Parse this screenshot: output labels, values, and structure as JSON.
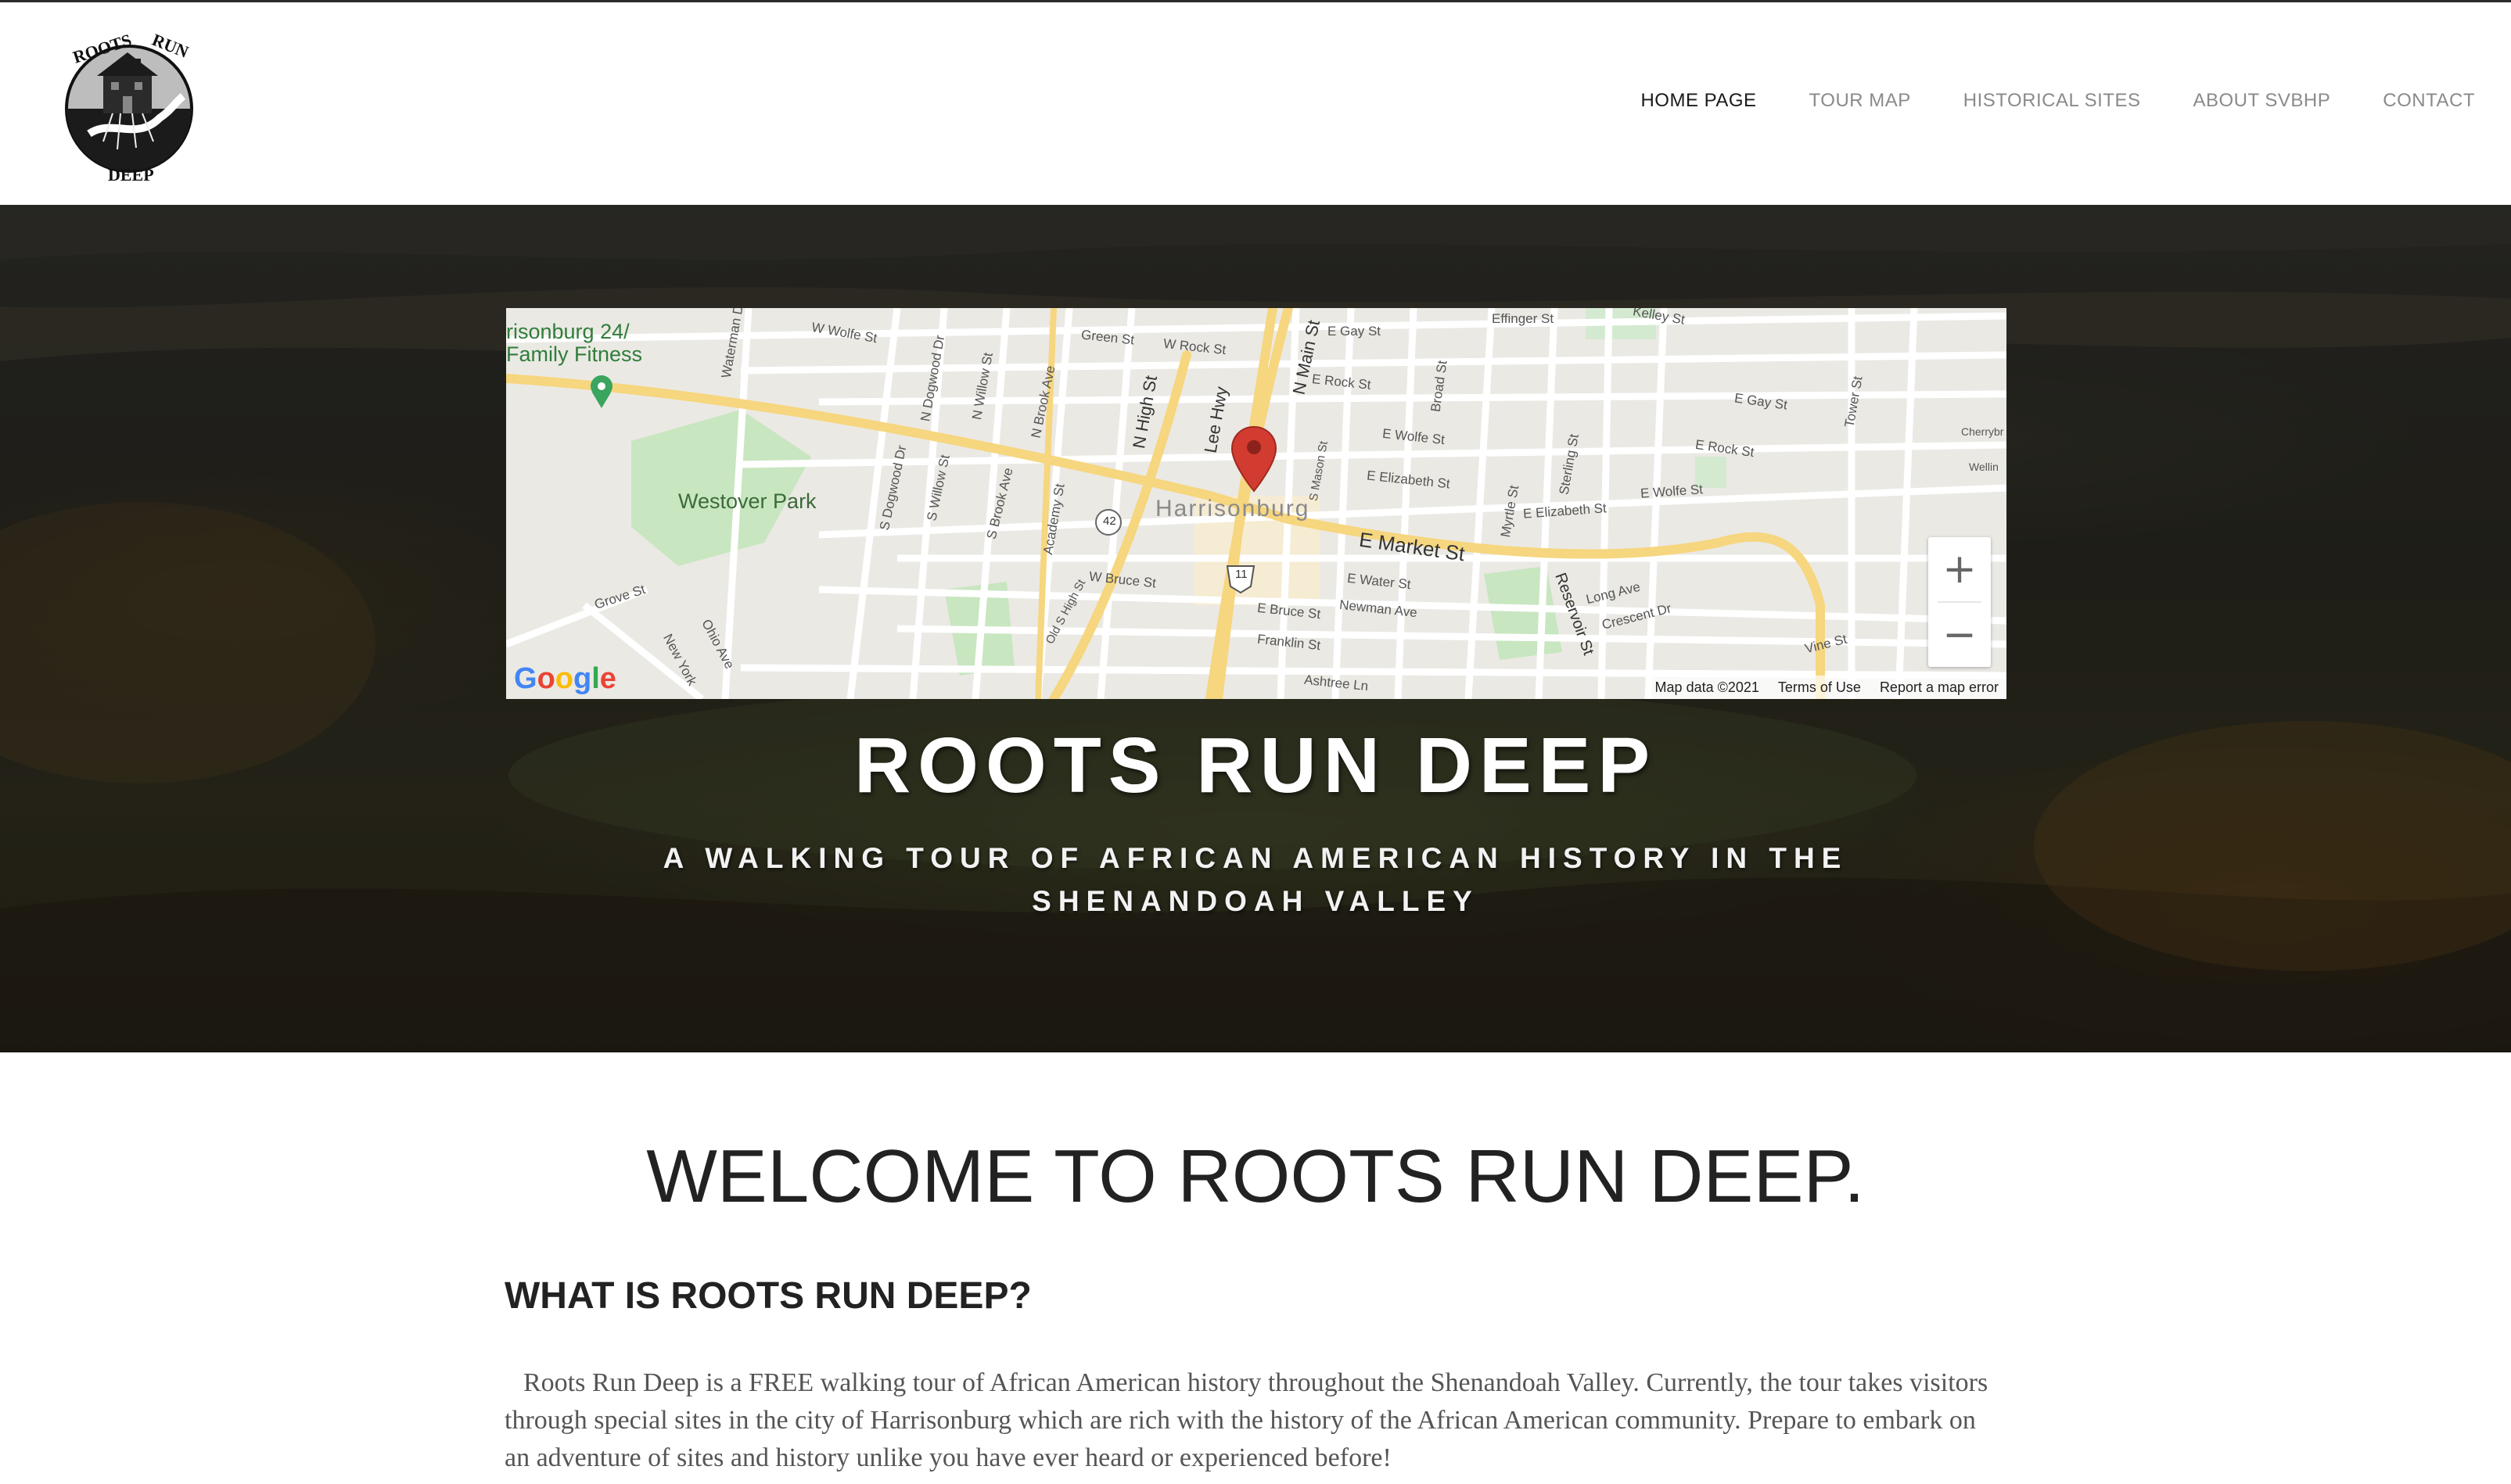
{
  "logo": {
    "top_text": "ROOTS",
    "top_text_2": "RUN",
    "bottom_text": "DEEP",
    "icon": "house-roots-logo"
  },
  "nav": {
    "items": [
      {
        "label": "HOME PAGE",
        "active": true
      },
      {
        "label": "TOUR MAP",
        "active": false
      },
      {
        "label": "HISTORICAL SITES",
        "active": false
      },
      {
        "label": "ABOUT SVBHP",
        "active": false
      },
      {
        "label": "CONTACT",
        "active": false
      }
    ]
  },
  "map": {
    "city_label": "Harrisonburg",
    "poi_park": "Westover Park",
    "poi_fitness_1": "risonburg 24/",
    "poi_fitness_2": "Family Fitness",
    "streets": {
      "e_market": "E Market St",
      "n_high": "N High St",
      "lee_hwy": "Lee Hwy",
      "n_main": "N Main St",
      "w_wolfe": "W Wolfe St",
      "green": "Green St",
      "w_rock": "W Rock St",
      "e_gay": "E Gay St",
      "e_rock": "E Rock St",
      "effinger": "Effinger St",
      "kelley": "Kelley St",
      "e_wolfe": "E Wolfe St",
      "e_elizabeth": "E Elizabeth St",
      "e_water": "E Water St",
      "newman": "Newman Ave",
      "franklin": "Franklin St",
      "e_bruce": "E Bruce St",
      "w_bruce": "W Bruce St",
      "reservoir": "Reservoir St",
      "long_ave": "Long Ave",
      "crescent": "Crescent Dr",
      "grove": "Grove St",
      "ohio": "Ohio Ave",
      "new_york": "New York",
      "s_dogwood": "S Dogwood Dr",
      "s_willow": "S Willow St",
      "s_brook": "S Brook Ave",
      "academy": "Academy St",
      "old_s_high": "Old S High St",
      "n_dogwood": "N Dogwood Dr",
      "n_willow": "N Willow St",
      "n_brook": "N Brook Ave",
      "waterman": "Waterman Dr",
      "broad": "Broad St",
      "myrtle": "Myrtle St",
      "sterling": "Sterling St",
      "tower": "Tower St",
      "vine": "Vine St",
      "ashtree": "Ashtree Ln",
      "cherrybr": "Cherrybr",
      "wellin": "Wellin",
      "s_mason": "S Mason St",
      "route_42": "42",
      "route_11": "11"
    },
    "zoom_in": "+",
    "zoom_out": "−",
    "google": "Google",
    "footer": {
      "data": "Map data ©2021",
      "terms": "Terms of Use",
      "report": "Report a map error"
    }
  },
  "hero": {
    "title": "ROOTS RUN DEEP",
    "subtitle_line1": "A WALKING TOUR OF AFRICAN AMERICAN HISTORY IN THE",
    "subtitle_line2": "SHENANDOAH VALLEY"
  },
  "content": {
    "welcome": "WELCOME TO ROOTS RUN DEEP.",
    "subhead": "WHAT IS ROOTS RUN DEEP?",
    "paragraph": "Roots Run Deep is a FREE walking tour of African American history throughout the Shenandoah Valley. Currently, the tour takes visitors through special sites in the city of Harrisonburg which are rich with the history of the African American community. Prepare to embark on an adventure of sites and history unlike you have ever heard or experienced before!"
  },
  "colors": {
    "nav_active": "#1a1a1a",
    "nav_inactive": "#8a8a8a",
    "pin": "#d23b2f",
    "park": "#c8e6c0",
    "road_major": "#f8dc8a"
  }
}
